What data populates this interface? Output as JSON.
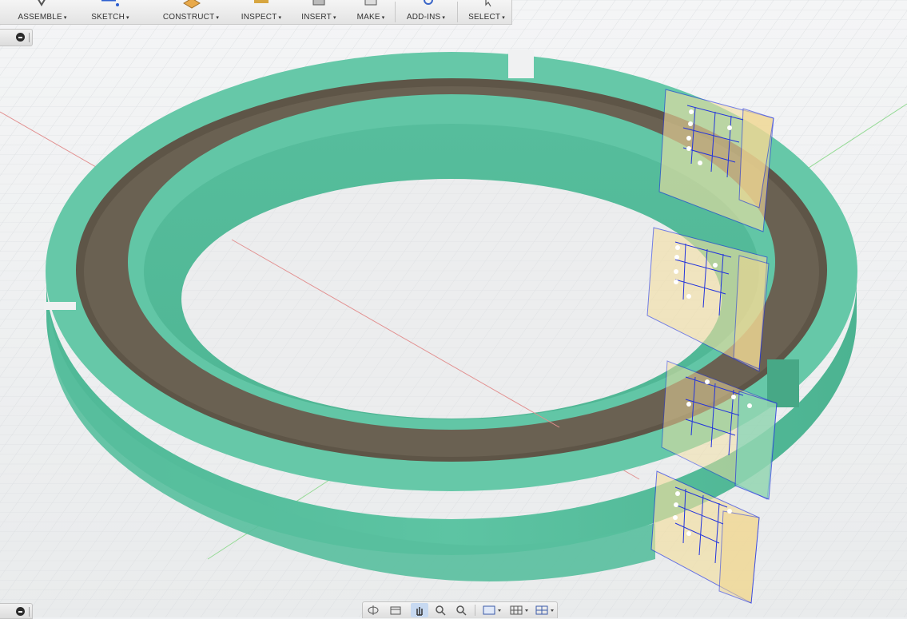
{
  "toolbar": {
    "items": [
      {
        "label": "ASSEMBLE",
        "icon": "assemble-icon"
      },
      {
        "label": "SKETCH",
        "icon": "sketch-icon"
      },
      {
        "label": "CONSTRUCT",
        "icon": "construct-plane-icon"
      },
      {
        "label": "INSPECT",
        "icon": "inspect-measure-icon"
      },
      {
        "label": "INSERT",
        "icon": "insert-image-icon"
      },
      {
        "label": "MAKE",
        "icon": "make-3d-print-icon"
      },
      {
        "label": "ADD-INS",
        "icon": "add-ins-gear-icon"
      },
      {
        "label": "SELECT",
        "icon": "select-cursor-icon"
      }
    ],
    "caret": "▾"
  },
  "viewport": {
    "model_color": "#5ec2a2",
    "channel_color": "#5f5648",
    "sketch_plane_color": "#f3dfa0",
    "sketch_line_color": "#2233dd",
    "grid_color": "#dde0e3",
    "x_axis_color": "#e08080",
    "y_axis_color": "#8fd88f"
  },
  "navigation_bar": {
    "tools": [
      "orbit-icon",
      "look-at-icon",
      "pan-icon",
      "zoom-window-icon",
      "fit-icon",
      "display-settings-icon",
      "grid-settings-icon",
      "viewports-icon"
    ]
  }
}
